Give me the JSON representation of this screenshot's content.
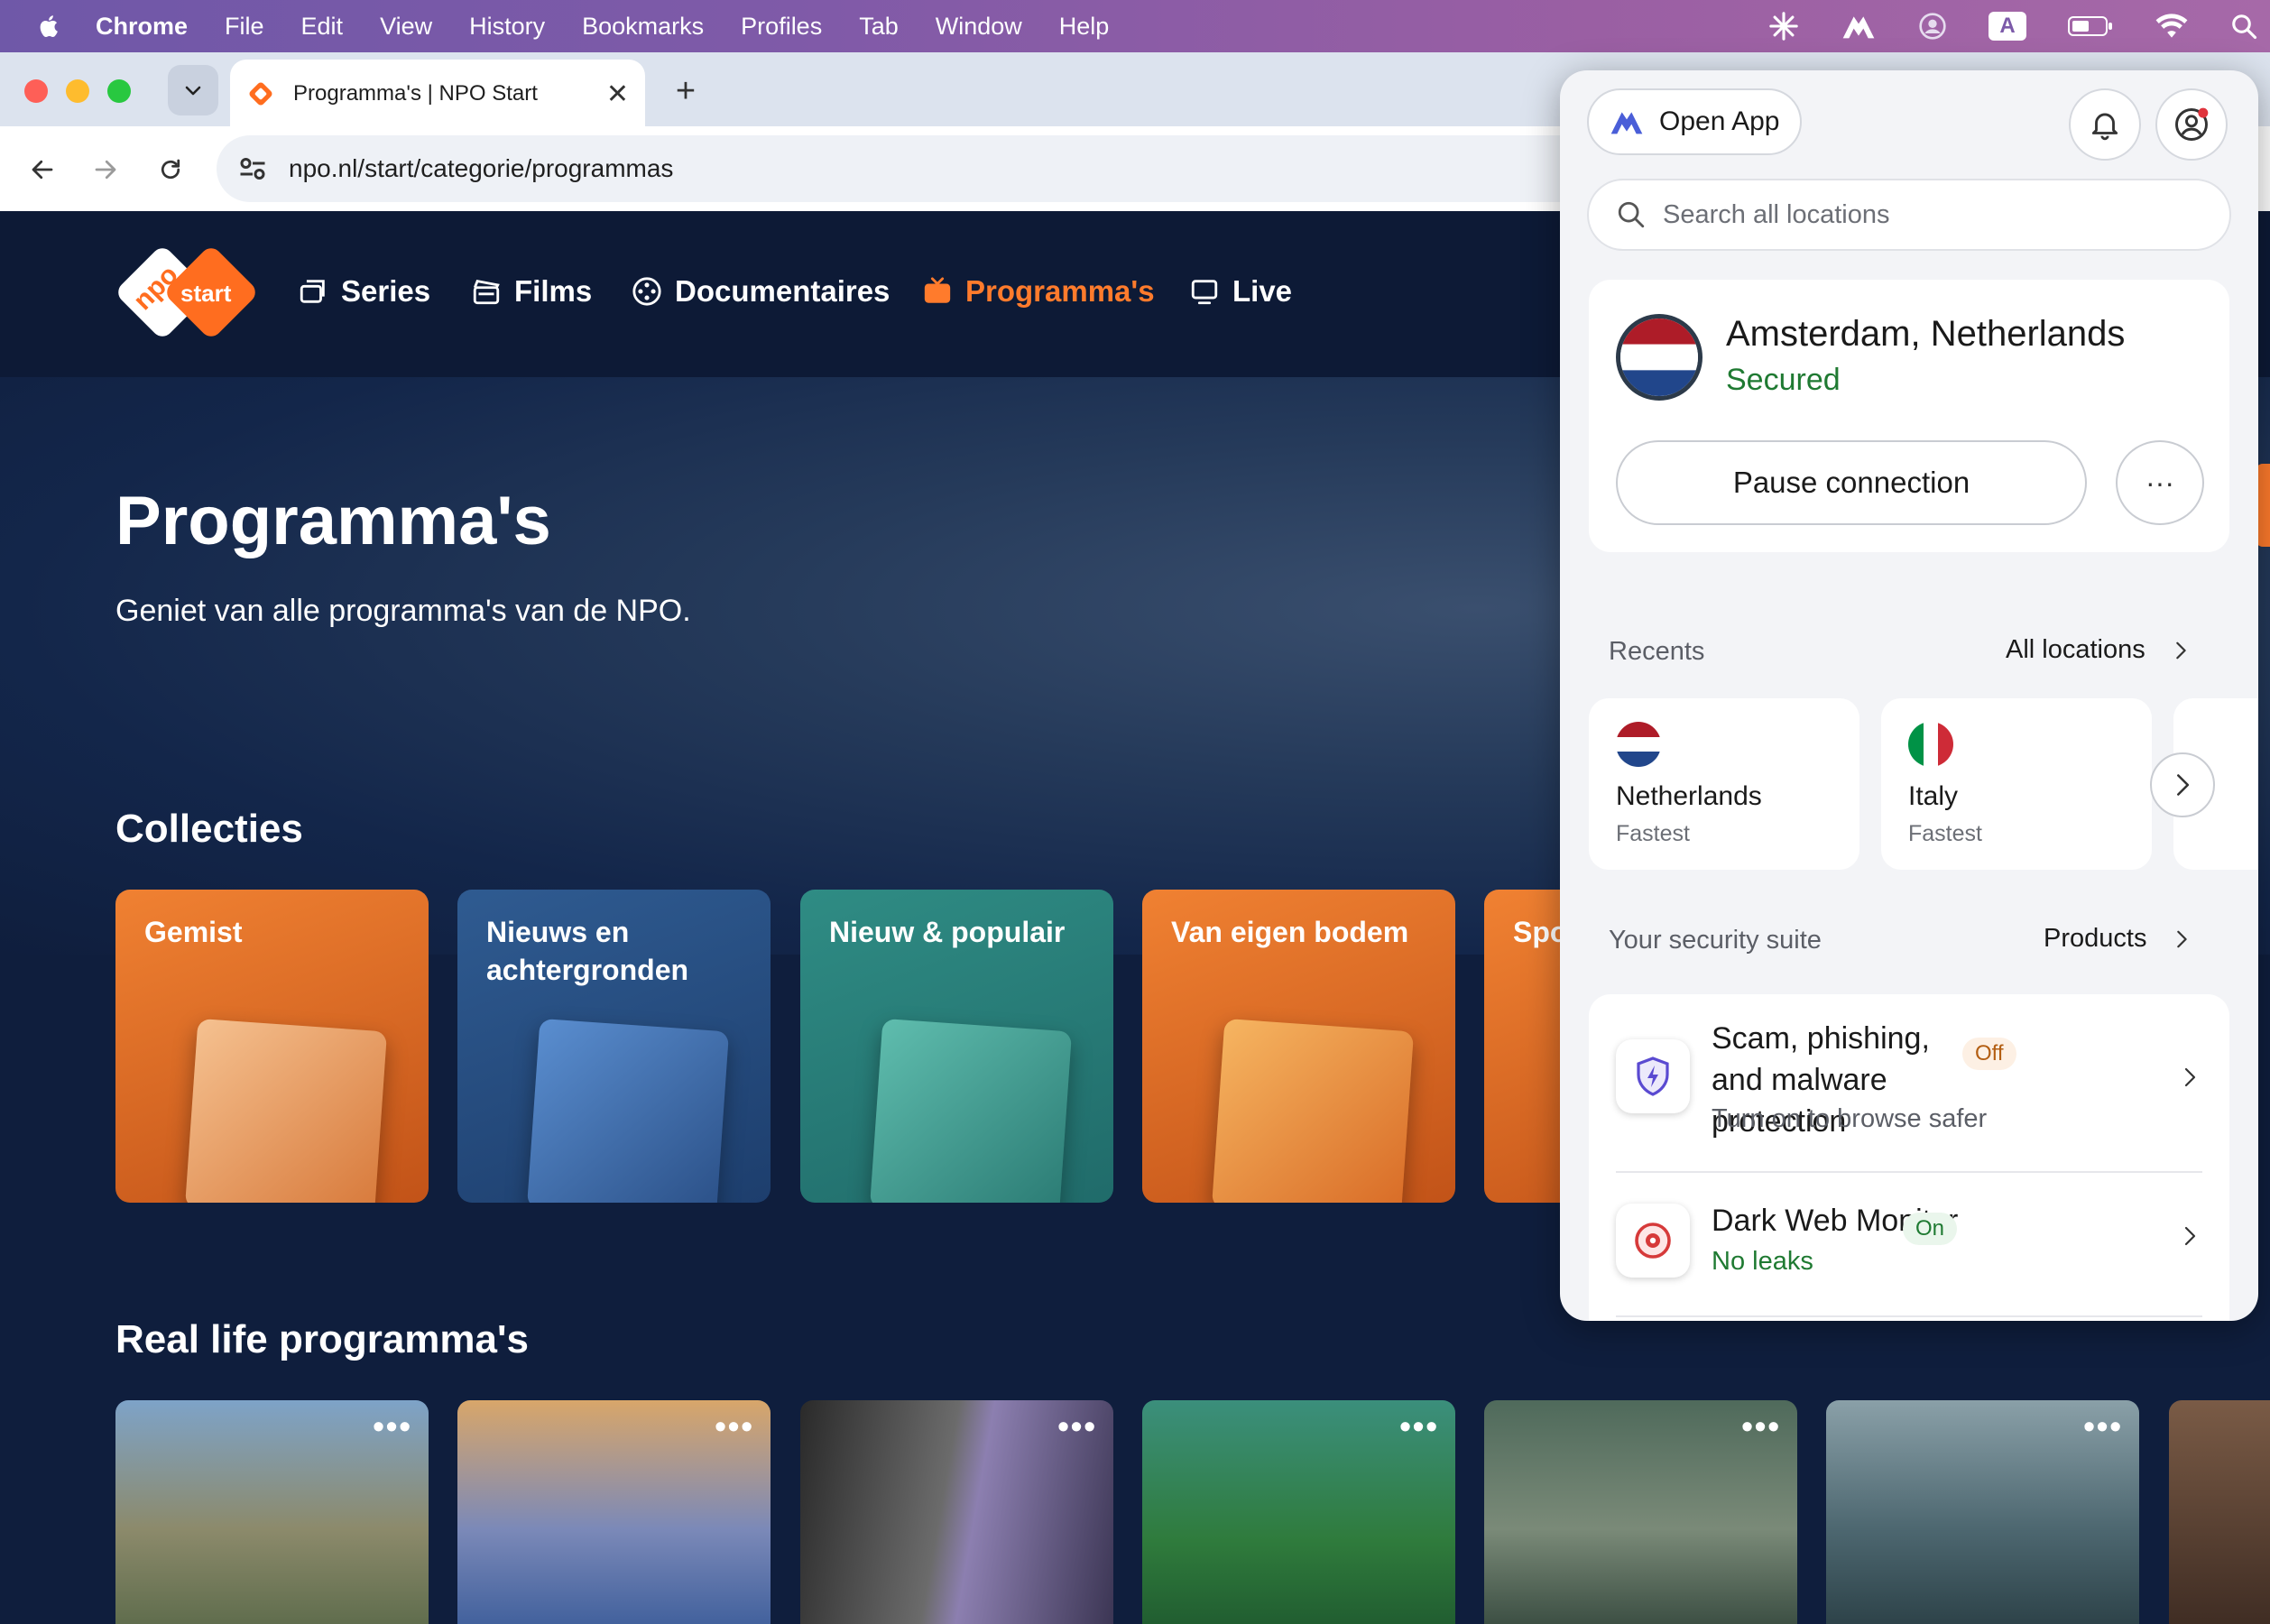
{
  "menubar": {
    "app_name": "Chrome",
    "items": [
      "File",
      "Edit",
      "View",
      "History",
      "Bookmarks",
      "Profiles",
      "Tab",
      "Window",
      "Help"
    ],
    "keyboard_input": "A"
  },
  "browser": {
    "tab_title": "Programma's | NPO Start",
    "url": "npo.nl/start/categorie/programmas"
  },
  "npo": {
    "nav": [
      "Series",
      "Films",
      "Documentaires",
      "Programma's",
      "Live"
    ],
    "active_nav": "Programma's",
    "hero_title": "Programma's",
    "hero_subtitle": "Geniet van alle programma's van de NPO.",
    "collections_title": "Collecties",
    "collections": [
      "Gemist",
      "Nieuws en achtergronden",
      "Nieuw & populair",
      "Van eigen bodem",
      "Spo"
    ],
    "real_life_title": "Real life programma's",
    "more_glyph": "•••"
  },
  "vpn": {
    "open_app": "Open App",
    "search_placeholder": "Search all locations",
    "location": "Amsterdam, Netherlands",
    "status": "Secured",
    "pause_label": "Pause connection",
    "more_glyph": "···",
    "recents_label": "Recents",
    "all_locations_label": "All locations",
    "recents": [
      {
        "name": "Netherlands",
        "sub": "Fastest"
      },
      {
        "name": "Italy",
        "sub": "Fastest"
      }
    ],
    "suite_label": "Your security suite",
    "products_label": "Products",
    "features": [
      {
        "title": "Scam, phishing, and malware protection",
        "badge": "Off",
        "desc": "Turn on to browse safer"
      },
      {
        "title": "Dark Web Monitor",
        "badge": "On",
        "desc": "No leaks"
      }
    ],
    "colors": {
      "secured": "#1f7a32",
      "off_badge": "#b35e12",
      "accent_orange": "#ff7b2c"
    }
  }
}
